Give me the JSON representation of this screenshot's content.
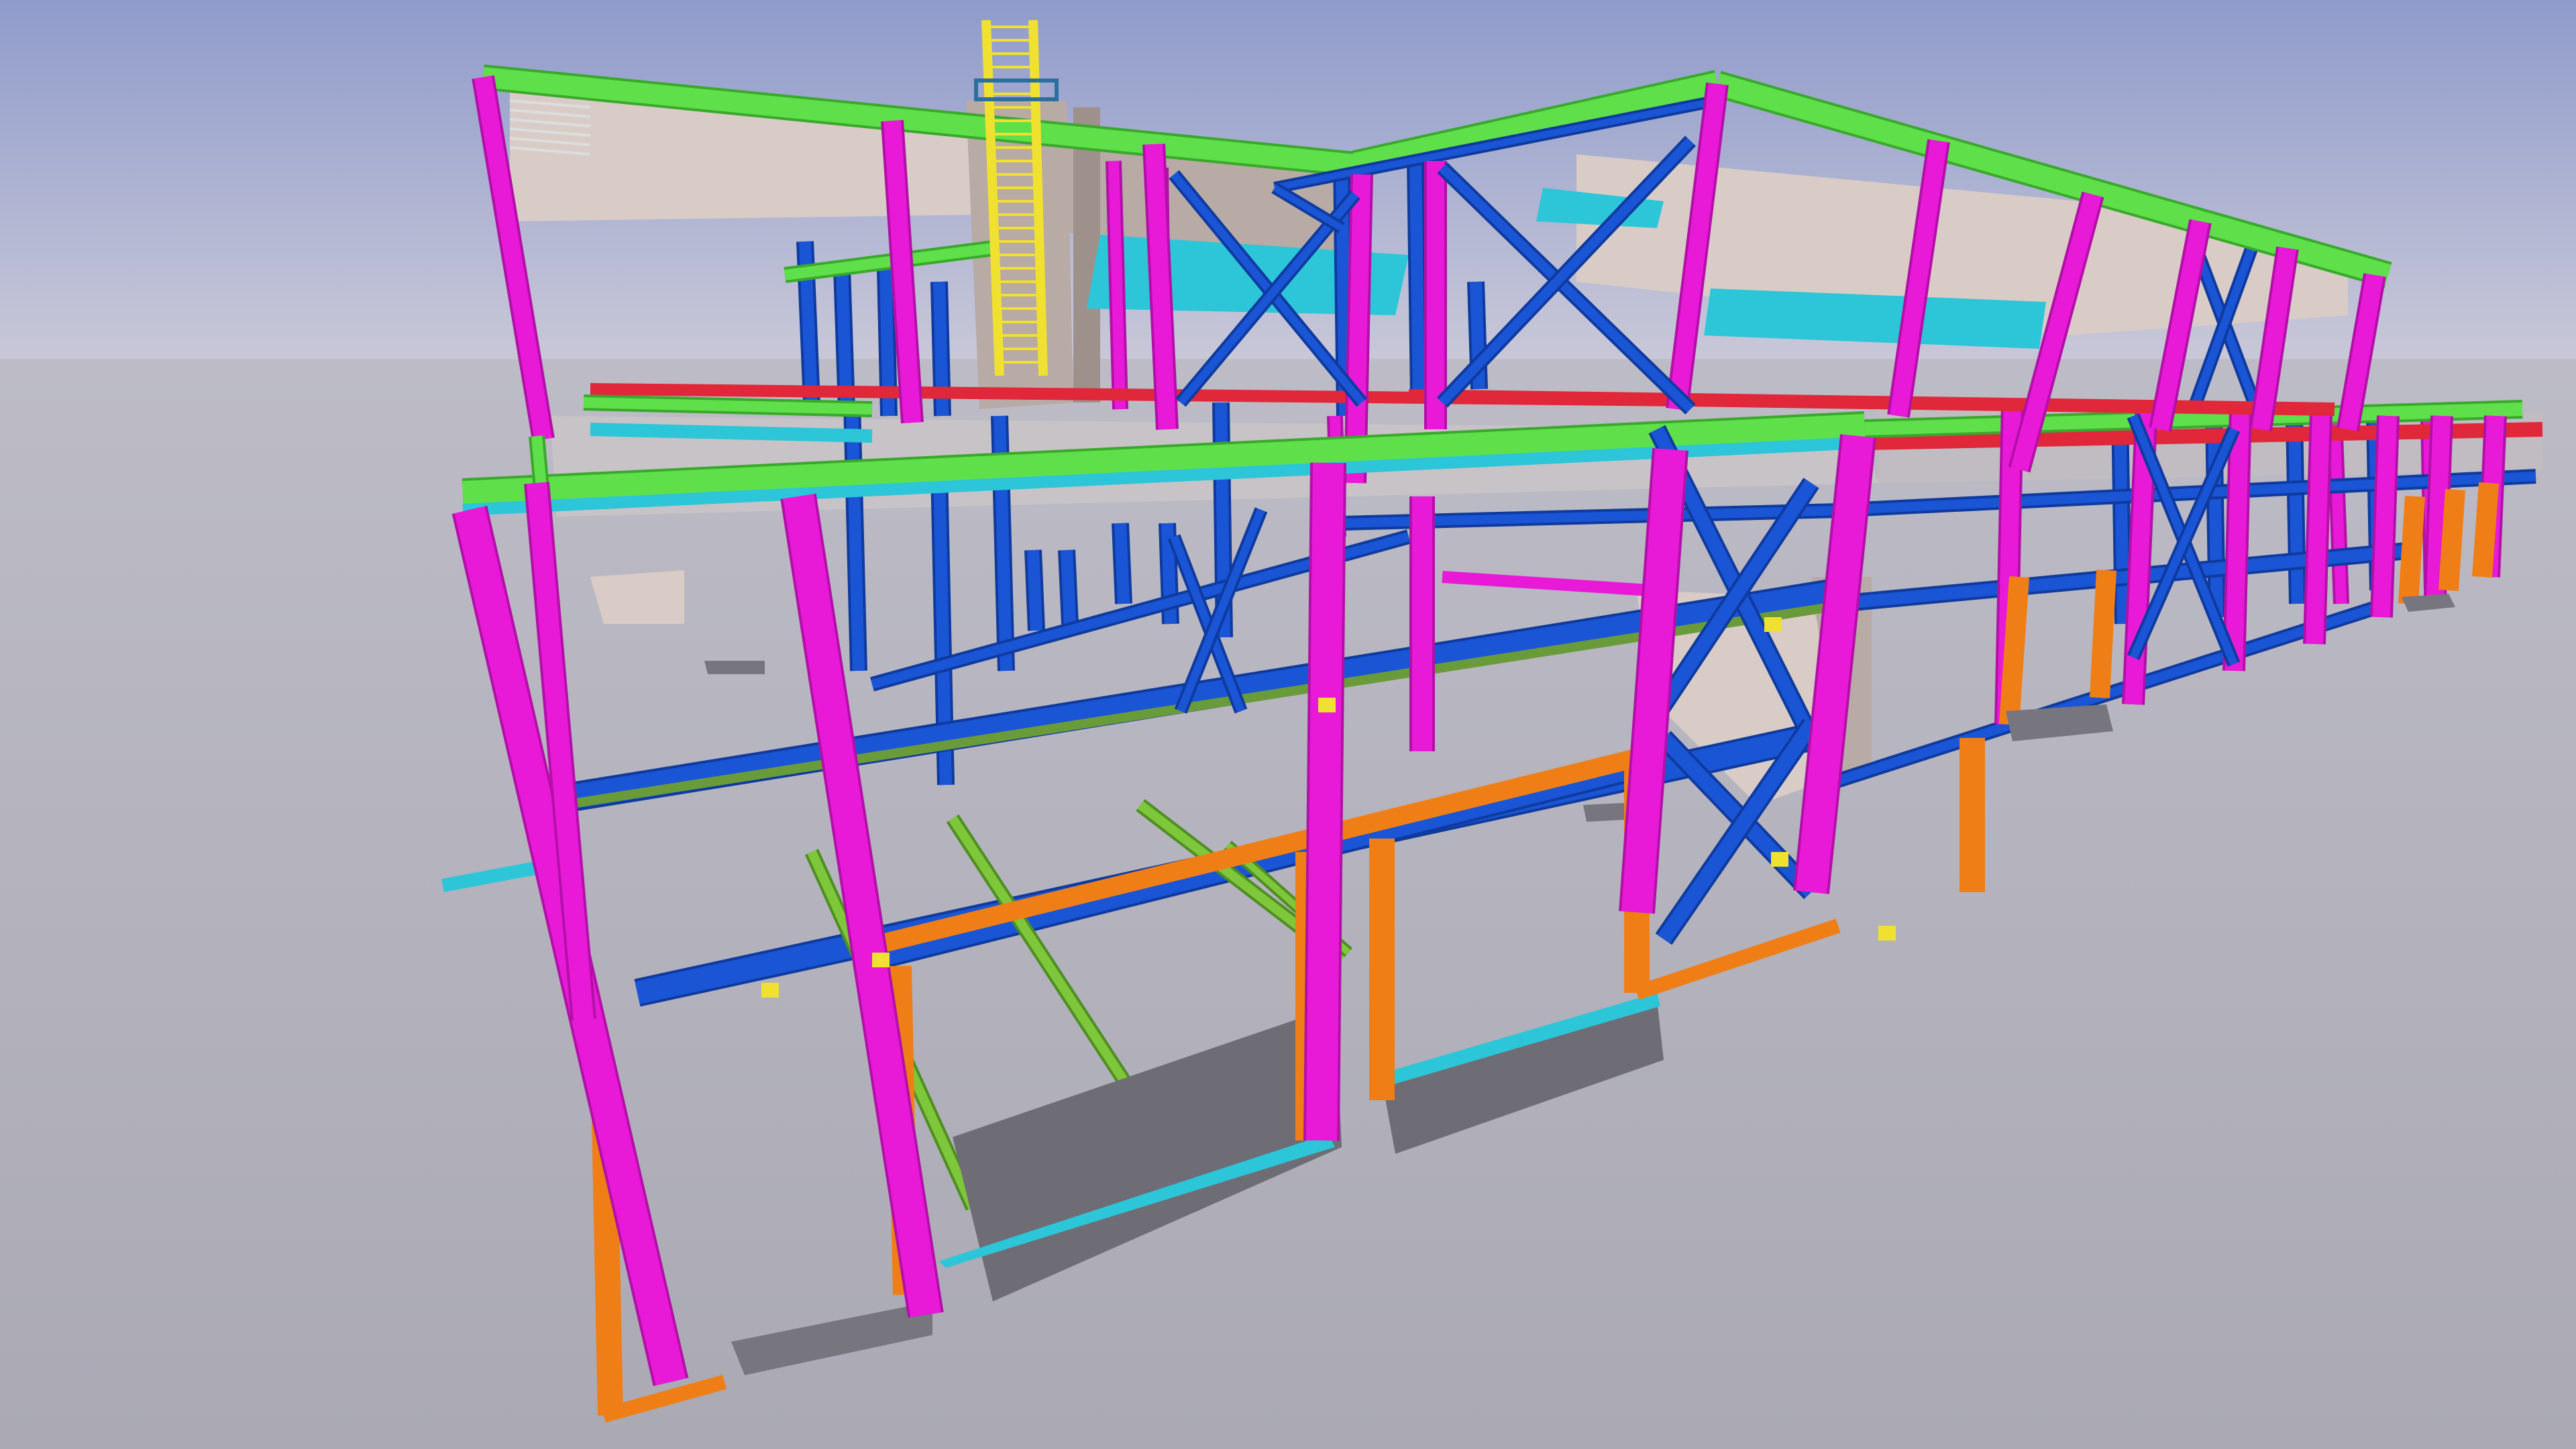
{
  "scene": {
    "subject": "steel-frame-structure",
    "colors": {
      "sky_top": "#8f9bcb",
      "sky_horizon": "#c9c8d8",
      "ground": "#aaa9b4",
      "column": "#e81ad8",
      "column_dark": "#b310a8",
      "beam_blue": "#1a55d6",
      "beam_blue_dark": "#0f3a9e",
      "roof_beam": "#5fe04a",
      "roof_beam_dark": "#3aa82c",
      "lower_column": "#f07e16",
      "slab": "#d9ccc6",
      "slab_dark": "#b8aaa4",
      "cyan": "#2cc6d8",
      "ladder": "#f0e030",
      "footing": "#77757e",
      "red": "#e0283a"
    }
  }
}
